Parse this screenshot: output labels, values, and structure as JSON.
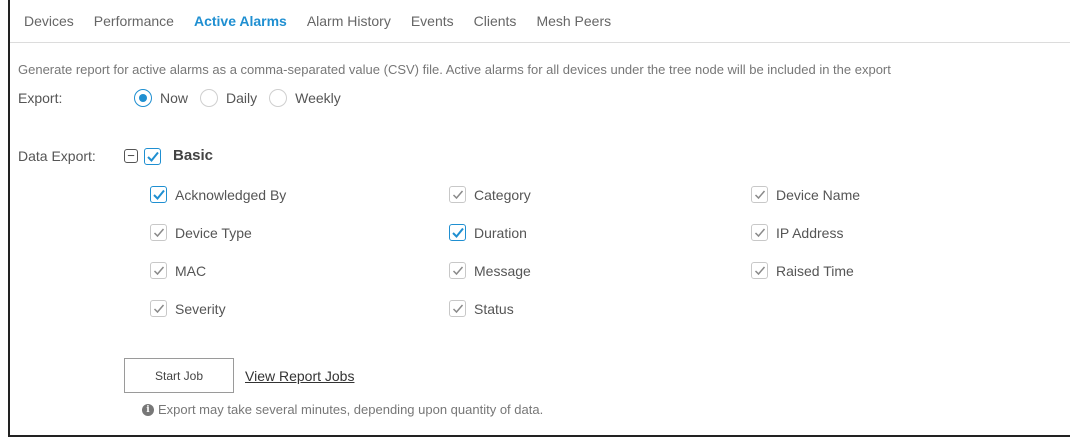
{
  "tabs": [
    "Devices",
    "Performance",
    "Active Alarms",
    "Alarm History",
    "Events",
    "Clients",
    "Mesh Peers"
  ],
  "active_tab_index": 2,
  "description": "Generate report for active alarms as a comma-separated value (CSV) file. Active alarms for all devices under the tree node will be included in the export",
  "export": {
    "label": "Export:",
    "options": [
      "Now",
      "Daily",
      "Weekly"
    ],
    "selected": "Now"
  },
  "data_export": {
    "label": "Data Export:",
    "group_label": "Basic",
    "group_checked": true,
    "fields": [
      {
        "label": "Acknowledged By",
        "checked": true
      },
      {
        "label": "Category",
        "checked": false
      },
      {
        "label": "Device Name",
        "checked": false
      },
      {
        "label": "Device Type",
        "checked": false
      },
      {
        "label": "Duration",
        "checked": true
      },
      {
        "label": "IP Address",
        "checked": false
      },
      {
        "label": "MAC",
        "checked": false
      },
      {
        "label": "Message",
        "checked": false
      },
      {
        "label": "Raised Time",
        "checked": false
      },
      {
        "label": "Severity",
        "checked": false
      },
      {
        "label": "Status",
        "checked": false
      }
    ]
  },
  "actions": {
    "start_job_label": "Start Job",
    "view_report_jobs_label": "View Report Jobs"
  },
  "note": "Export may take several minutes, depending upon quantity of data.",
  "colors": {
    "accent": "#1f8fd1",
    "text": "#555555",
    "muted_check": "#8a8a8a"
  }
}
